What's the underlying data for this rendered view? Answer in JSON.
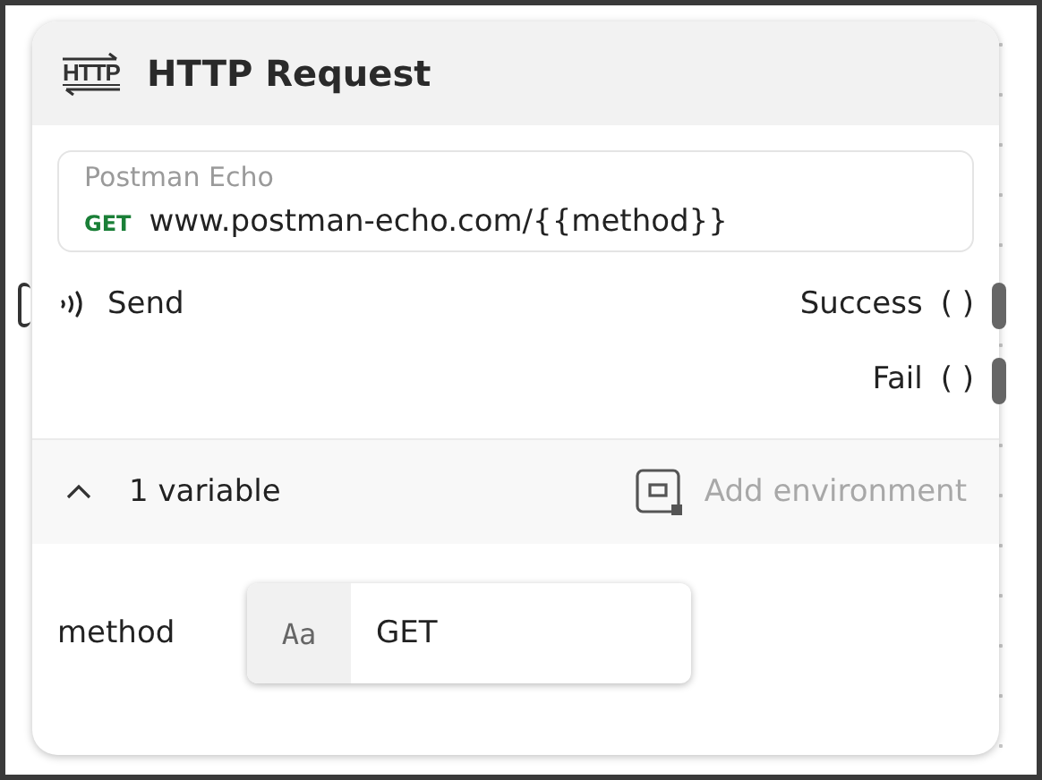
{
  "node": {
    "icon_label": "HTTP",
    "title": "HTTP Request"
  },
  "request": {
    "name": "Postman Echo",
    "method": "GET",
    "url": "www.postman-echo.com/{{method}}"
  },
  "inputs": [
    {
      "label": "Send"
    }
  ],
  "outputs": [
    {
      "label": "Success",
      "signature": "( )"
    },
    {
      "label": "Fail",
      "signature": "( )"
    }
  ],
  "variables_section": {
    "title": "1 variable",
    "expanded": true,
    "action": "Add environment"
  },
  "variables": [
    {
      "name": "method",
      "type_label": "Aa",
      "value": "GET"
    }
  ]
}
